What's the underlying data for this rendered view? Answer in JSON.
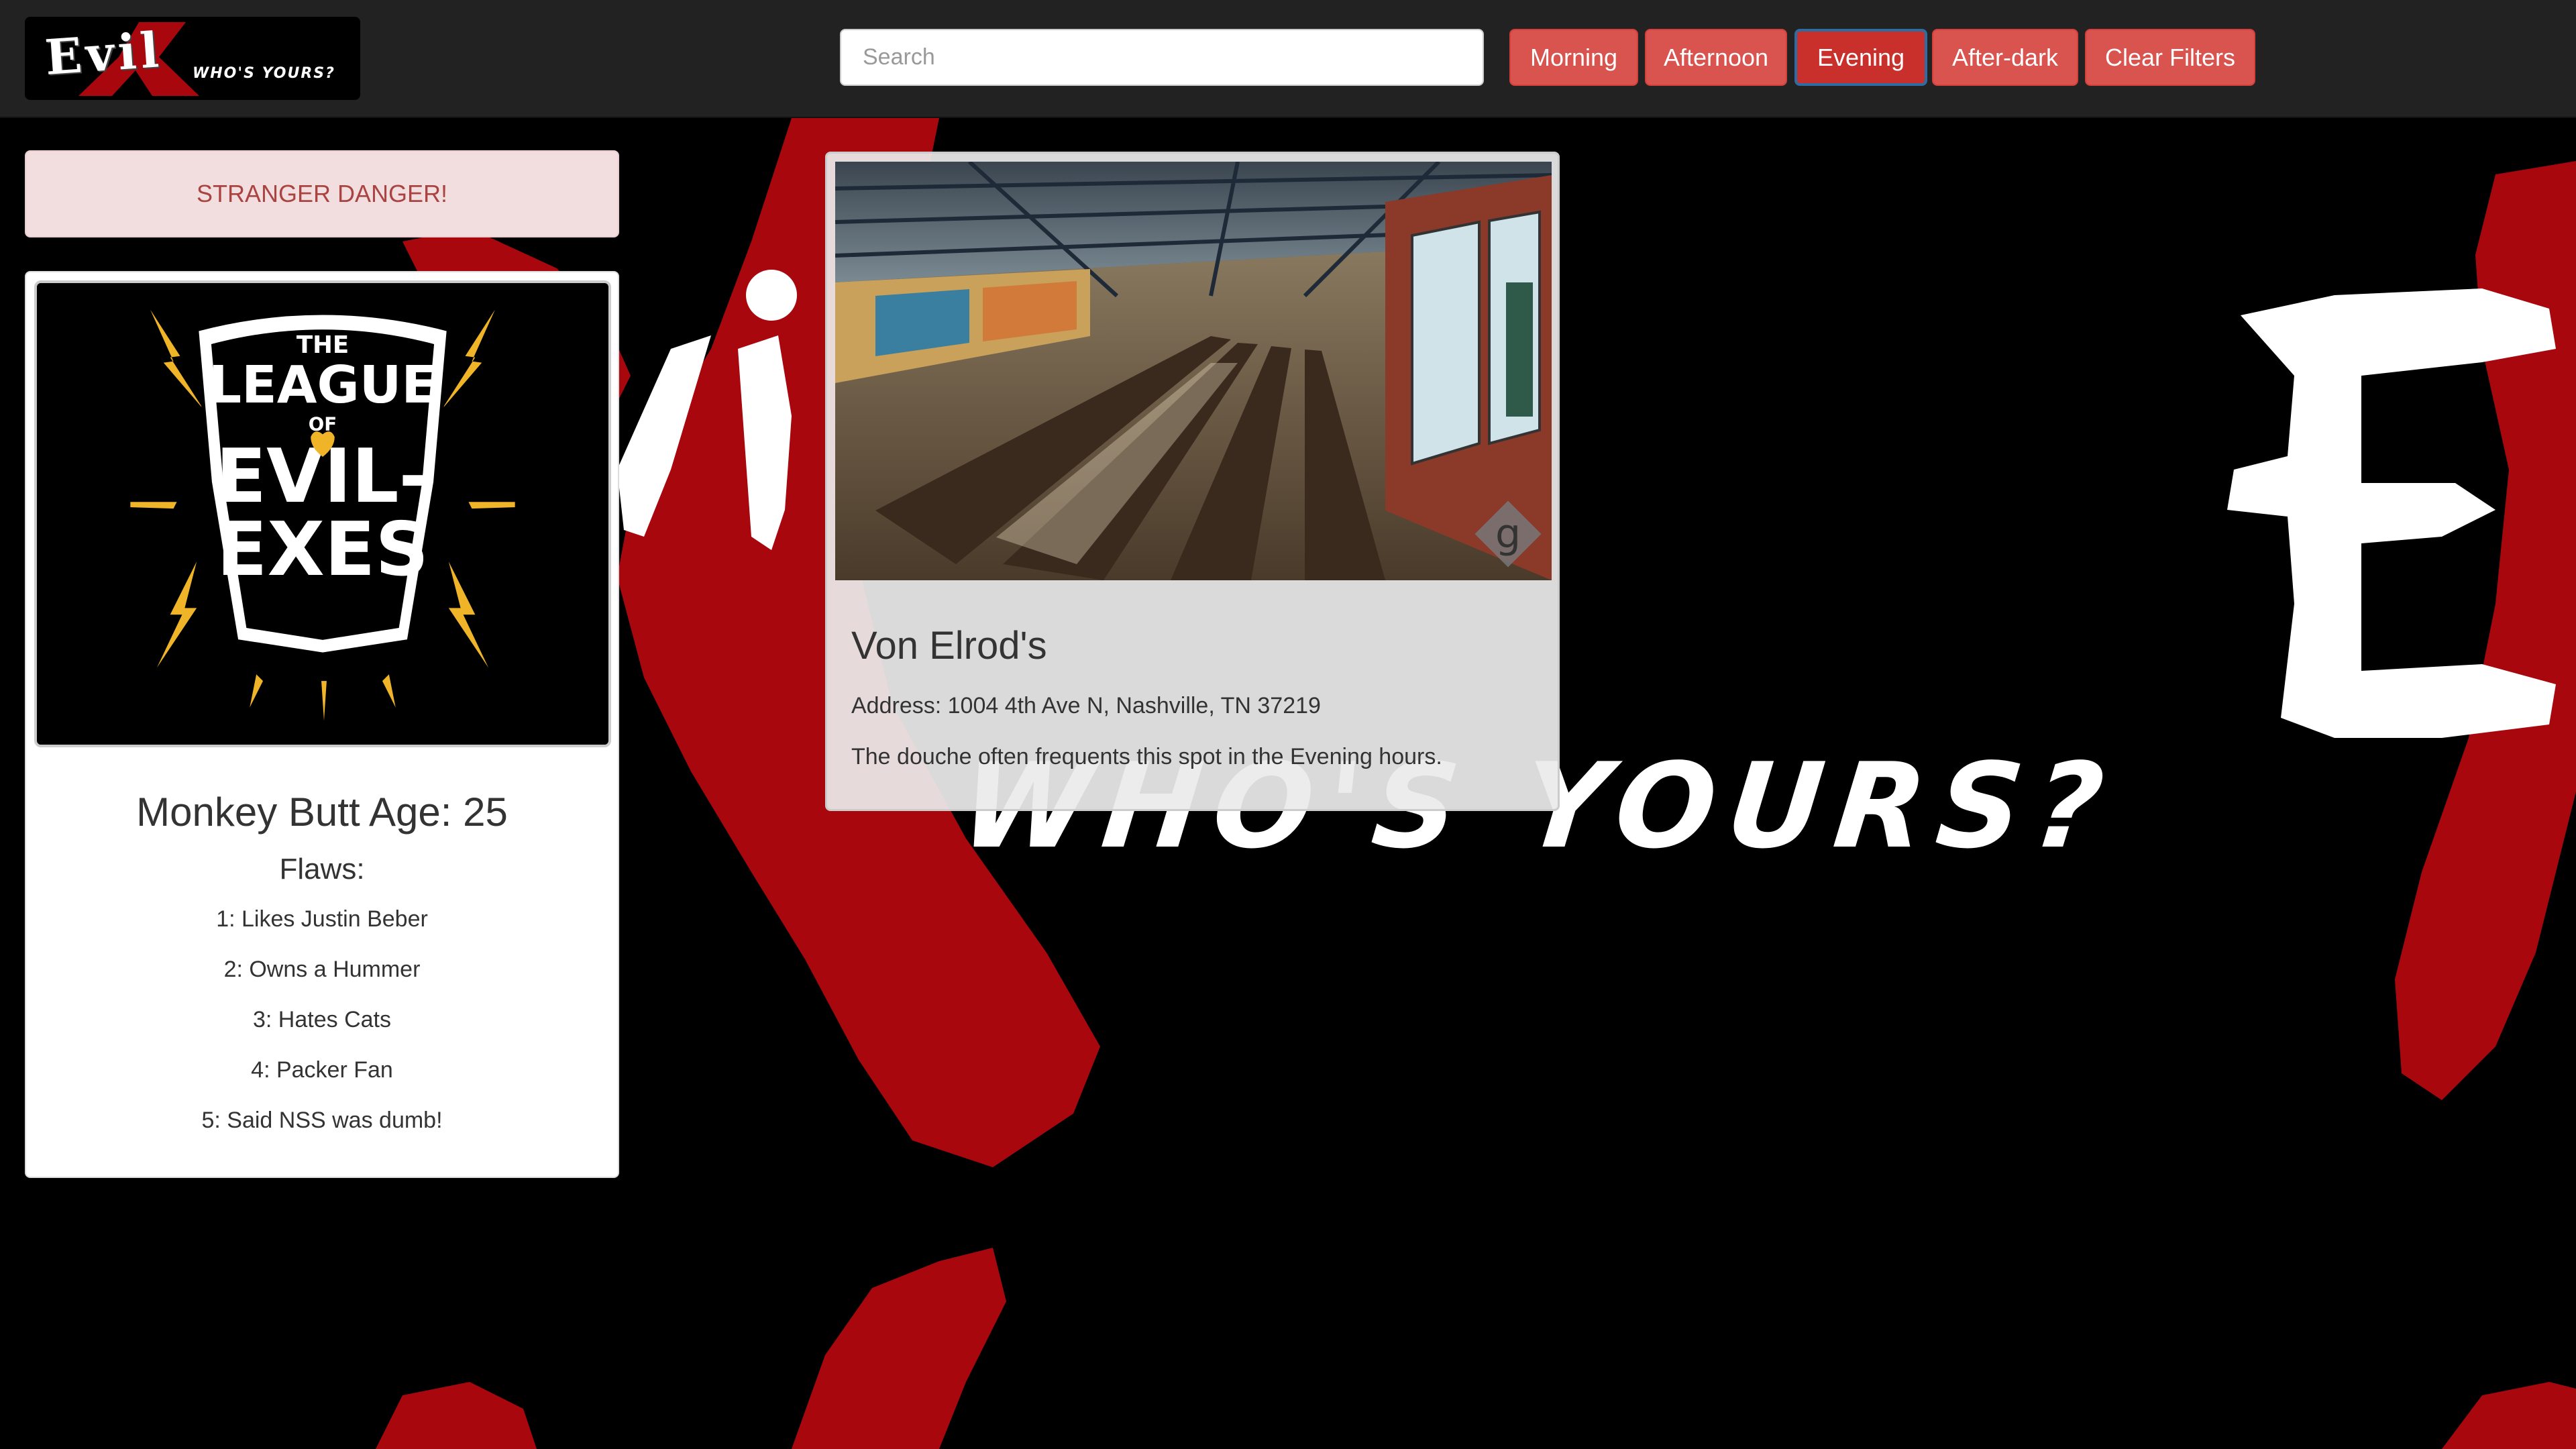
{
  "brand": {
    "logo_word": "Evil",
    "logo_tagline": "WHO'S YOURS?"
  },
  "background": {
    "tagline": "WHO'S YOURS?"
  },
  "search": {
    "placeholder": "Search"
  },
  "filters": [
    {
      "label": "Morning",
      "active": false
    },
    {
      "label": "Afternoon",
      "active": false
    },
    {
      "label": "Evening",
      "active": true
    },
    {
      "label": "After-dark",
      "active": false
    },
    {
      "label": "Clear Filters",
      "active": false
    }
  ],
  "alert": {
    "text": "STRANGER DANGER!"
  },
  "profile": {
    "image_text": [
      "THE",
      "LEAGUE",
      "OF",
      "EVIL-",
      "EXES"
    ],
    "name_age": "Monkey Butt Age: 25",
    "flaws_heading": "Flaws:",
    "flaws": [
      "1: Likes Justin Beber",
      "2: Owns a Hummer",
      "3: Hates Cats",
      "4: Packer Fan",
      "5: Said NSS was dumb!"
    ]
  },
  "location": {
    "name": "Von Elrod's",
    "address": "Address: 1004 4th Ave N, Nashville, TN 37219",
    "description": "The douche often frequents this spot in the Evening hours.",
    "badge": "g"
  },
  "colors": {
    "accent_red": "#d9534f",
    "blood_red": "#a8070d",
    "navbar": "#222222",
    "alert_bg": "#f2dede",
    "alert_text": "#a94442",
    "active_border": "#2e6da4"
  },
  "icons": {
    "brand": "evil-x-logo",
    "badge": "google-g-icon"
  }
}
